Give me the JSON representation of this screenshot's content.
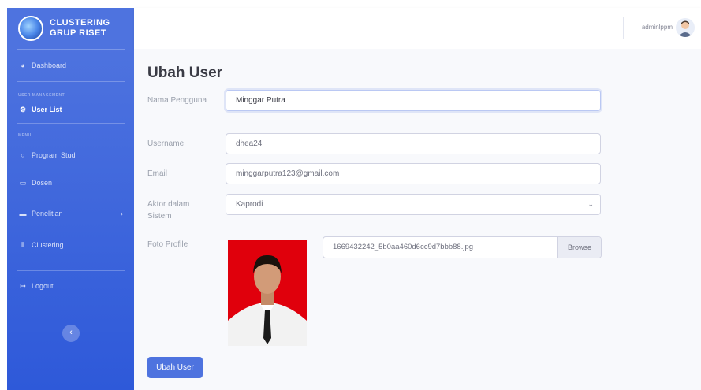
{
  "brand": {
    "line1": "CLUSTERING",
    "line2": "GRUP RISET"
  },
  "sidebar": {
    "dashboard": "Dashboard",
    "heading_user": "USER MANAGEMENT",
    "user_list": "User List",
    "heading_menu": "MENU",
    "program_studi": "Program Studi",
    "dosen": "Dosen",
    "penelitian": "Penelitian",
    "clustering": "Clustering",
    "logout": "Logout",
    "toggle": "‹"
  },
  "topbar": {
    "user": "adminlppm"
  },
  "page": {
    "title": "Ubah User"
  },
  "form": {
    "name_label": "Nama Pengguna",
    "name_value": "Minggar Putra",
    "username_label": "Username",
    "username_value": "dhea24",
    "email_label": "Email",
    "email_value": "minggarputra123@gmail.com",
    "role_label": "Aktor dalam Sistem",
    "role_value": "Kaprodi",
    "photo_label": "Foto Profile",
    "file_name": "1669432242_5b0aa460d6cc9d7bbb88.jpg",
    "browse": "Browse",
    "submit": "Ubah User"
  },
  "icons": {
    "dashboard": "dashboard-icon",
    "user_list": "gear-icon",
    "program_studi": "circle-icon",
    "dosen": "book-icon",
    "penelitian": "folder-icon",
    "clustering": "chart-icon",
    "logout": "logout-icon"
  },
  "colors": {
    "primary": "#4e73df",
    "photo_background": "#e0000c"
  }
}
